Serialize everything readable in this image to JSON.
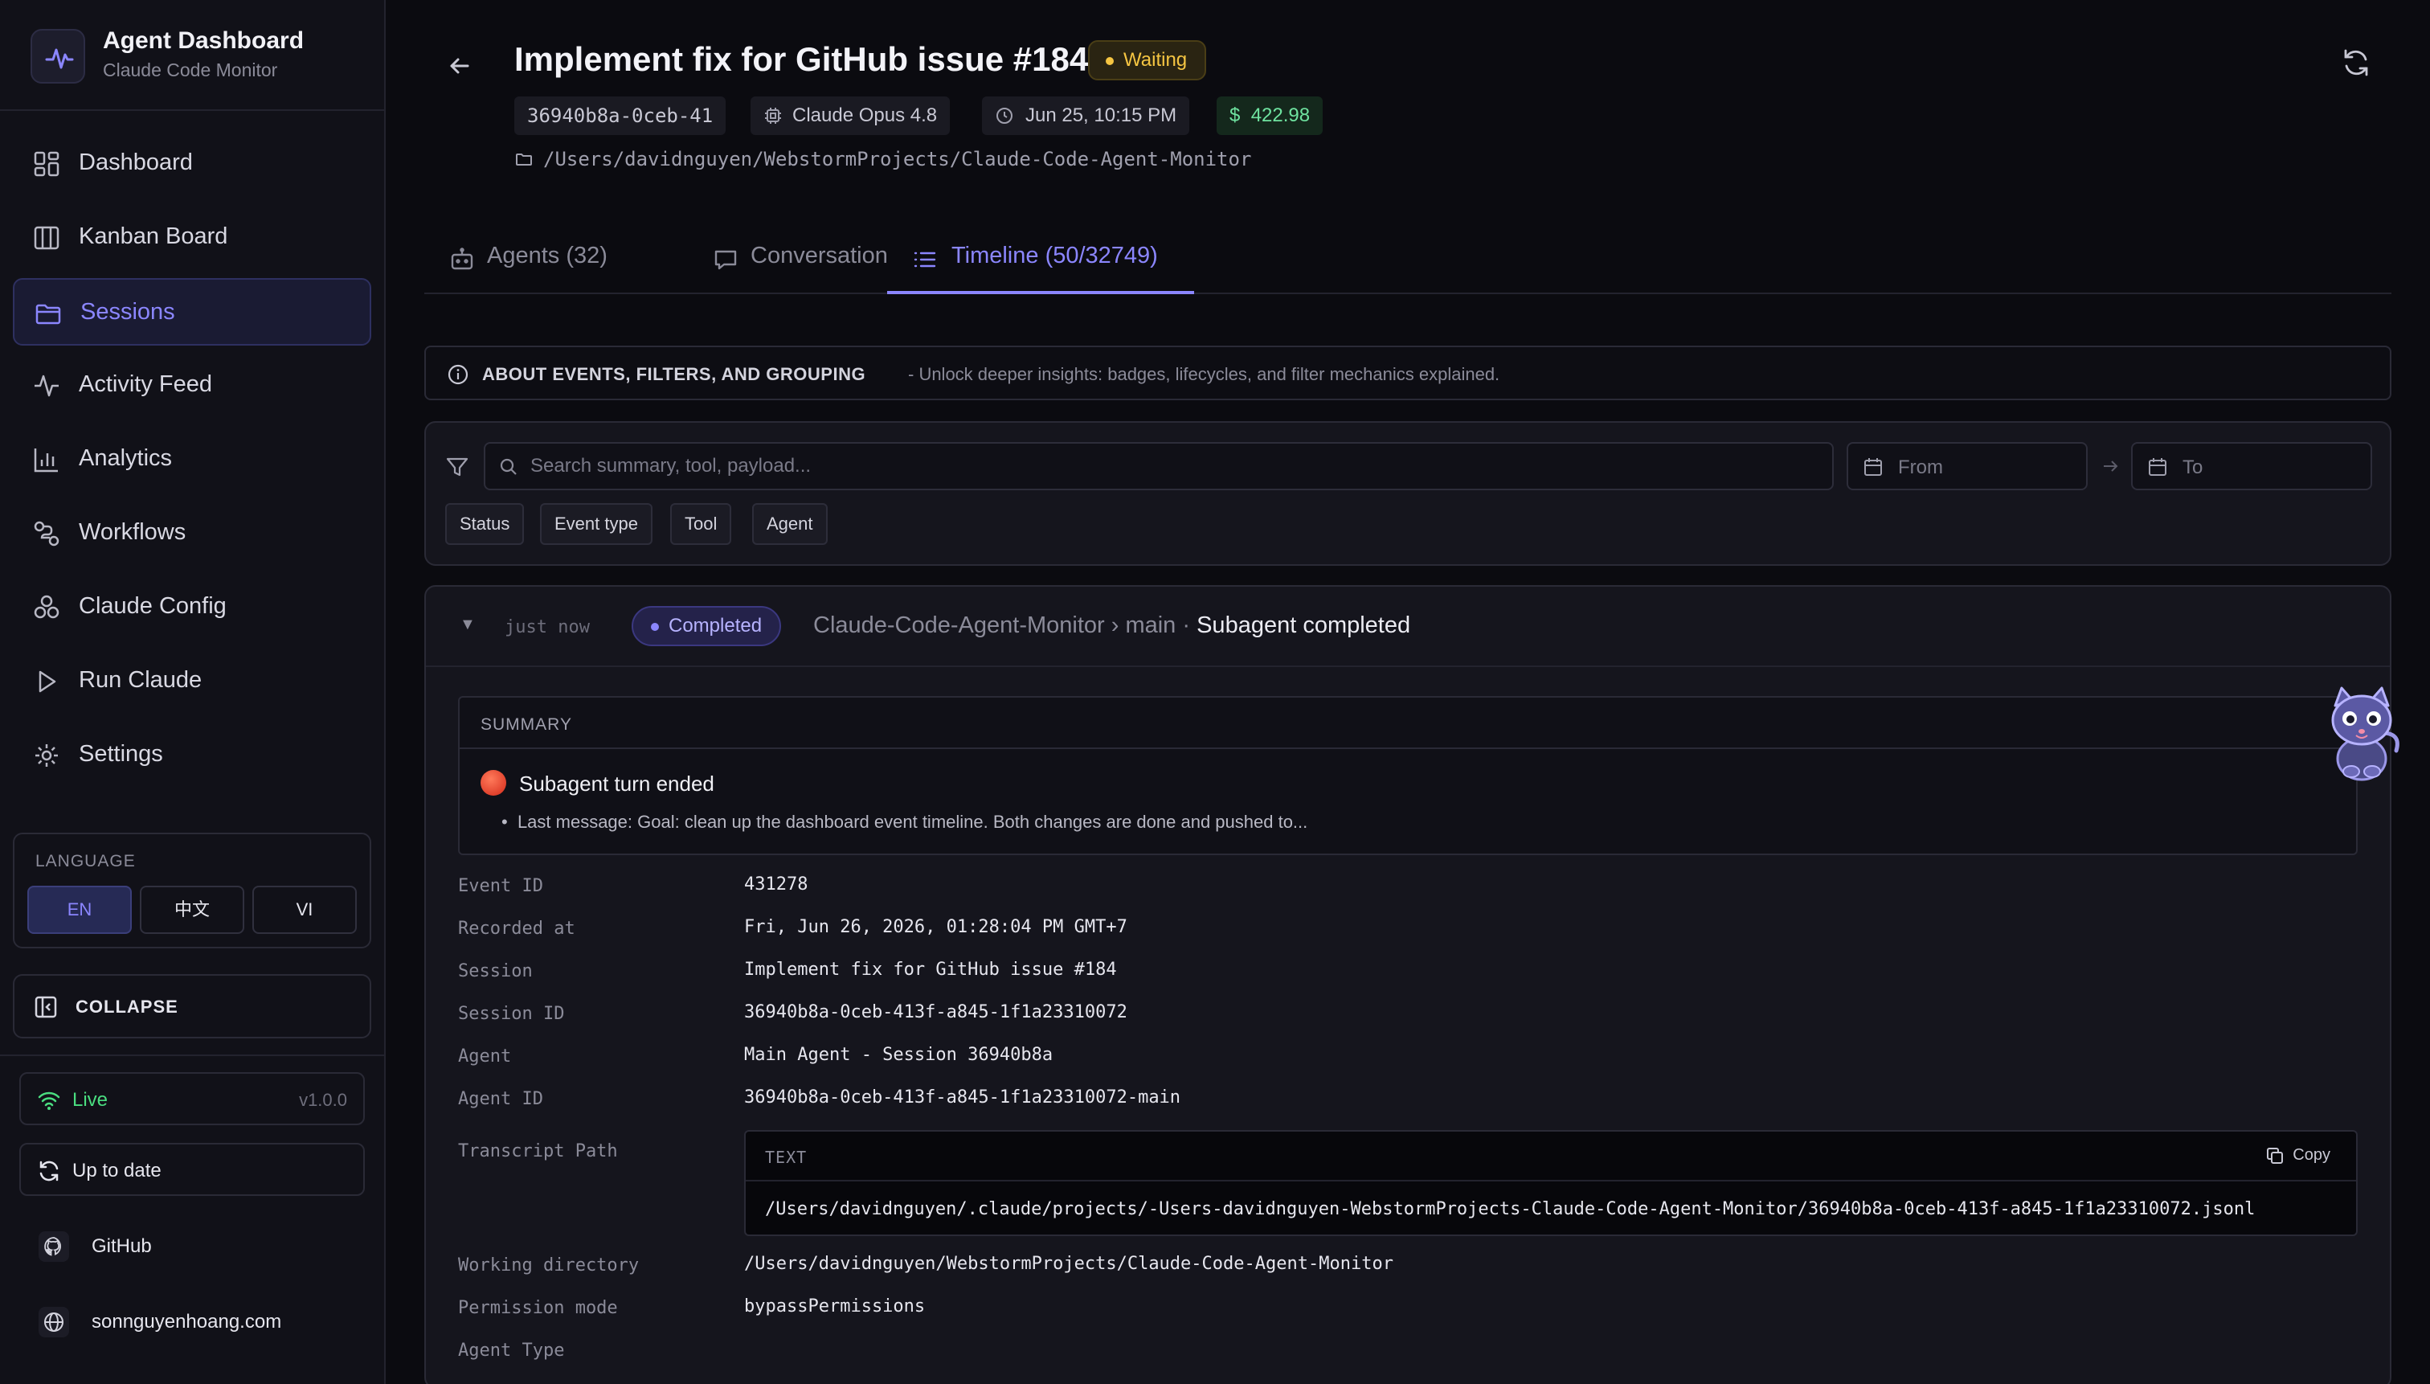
{
  "sidebar": {
    "brand_title": "Agent Dashboard",
    "brand_subtitle": "Claude Code Monitor",
    "items": [
      {
        "label": "Dashboard",
        "icon": "dashboard-icon"
      },
      {
        "label": "Kanban Board",
        "icon": "kanban-icon"
      },
      {
        "label": "Sessions",
        "icon": "folder-icon",
        "active": true
      },
      {
        "label": "Activity Feed",
        "icon": "activity-icon"
      },
      {
        "label": "Analytics",
        "icon": "bar-chart-icon"
      },
      {
        "label": "Workflows",
        "icon": "workflow-icon"
      },
      {
        "label": "Claude Config",
        "icon": "cubes-icon"
      },
      {
        "label": "Run Claude",
        "icon": "play-icon"
      },
      {
        "label": "Settings",
        "icon": "gear-icon"
      }
    ],
    "language": {
      "title": "LANGUAGE",
      "options": [
        "EN",
        "中文",
        "VI"
      ],
      "selected": "EN"
    },
    "collapse_label": "COLLAPSE",
    "live_label": "Live",
    "version": "v1.0.0",
    "update_label": "Up to date",
    "github_label": "GitHub",
    "website_label": "sonnguyenhoang.com"
  },
  "header": {
    "title": "Implement fix for GitHub issue #184",
    "status": "Waiting",
    "session_short_id": "36940b8a-0ceb-41",
    "model": "Claude Opus 4.8",
    "started": "Jun 25, 10:15 PM",
    "cost_symbol": "$",
    "cost": "422.98",
    "path": "/Users/davidnguyen/WebstormProjects/Claude-Code-Agent-Monitor"
  },
  "tabs": [
    {
      "label": "Agents (32)",
      "icon": "robot-icon"
    },
    {
      "label": "Conversation",
      "icon": "chat-icon"
    },
    {
      "label": "Timeline (50/32749)",
      "icon": "list-icon",
      "active": true
    }
  ],
  "about": {
    "title": "ABOUT EVENTS, FILTERS, AND GROUPING",
    "description": "- Unlock deeper insights: badges, lifecycles, and filter mechanics explained."
  },
  "filters": {
    "search_placeholder": "Search summary, tool, payload...",
    "from_placeholder": "From",
    "to_placeholder": "To",
    "chips": [
      "Status",
      "Event type",
      "Tool",
      "Agent"
    ]
  },
  "event": {
    "time": "just now",
    "status": "Completed",
    "path_prefix": "Claude-Code-Agent-Monitor › main ·",
    "path_event": "Subagent completed",
    "summary_title": "SUMMARY",
    "summary_line": "Subagent turn ended",
    "summary_bullet": "Last message: Goal: clean up the dashboard event timeline. Both changes are done and pushed to...",
    "fields": {
      "event_id_key": "Event ID",
      "event_id": "431278",
      "recorded_key": "Recorded at",
      "recorded": "Fri, Jun 26, 2026, 01:28:04 PM GMT+7",
      "session_key": "Session",
      "session": "Implement fix for GitHub issue #184",
      "session_id_key": "Session ID",
      "session_id": "36940b8a-0ceb-413f-a845-1f1a23310072",
      "agent_key": "Agent",
      "agent": "Main Agent - Session 36940b8a",
      "agent_id_key": "Agent ID",
      "agent_id": "36940b8a-0ceb-413f-a845-1f1a23310072-main",
      "transcript_key": "Transcript Path",
      "transcript_type": "TEXT",
      "copy_label": "Copy",
      "transcript": "/Users/davidnguyen/.claude/projects/-Users-davidnguyen-WebstormProjects-Claude-Code-Agent-Monitor/36940b8a-0ceb-413f-a845-1f1a23310072.jsonl",
      "workdir_key": "Working directory",
      "workdir": "/Users/davidnguyen/WebstormProjects/Claude-Code-Agent-Monitor",
      "permission_key": "Permission mode",
      "permission": "bypassPermissions",
      "agent_type_key": "Agent Type"
    }
  },
  "colors": {
    "accent": "#8b86ff",
    "waiting": "#f5c542",
    "live": "#4ade80",
    "cost": "#6fe3a0"
  }
}
